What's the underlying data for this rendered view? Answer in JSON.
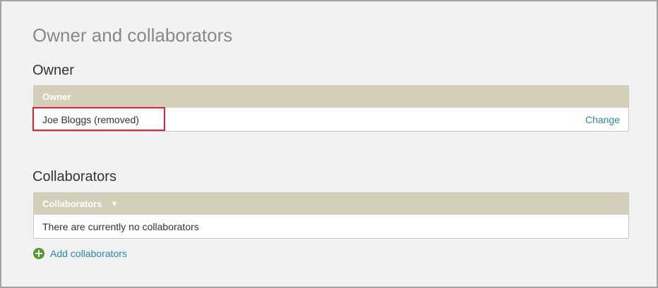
{
  "page": {
    "title": "Owner and collaborators"
  },
  "owner": {
    "heading": "Owner",
    "table_header": "Owner",
    "name": "Joe Bloggs (removed)",
    "change_label": "Change"
  },
  "collaborators": {
    "heading": "Collaborators",
    "table_header": "Collaborators",
    "sort_icon": "▼",
    "empty_message": "There are currently no collaborators",
    "add_label": "Add collaborators"
  },
  "colors": {
    "panel_header": "#d3cfb9",
    "link": "#2a86b8",
    "highlight": "#e0232f",
    "add_icon": "#4a9d2a"
  }
}
